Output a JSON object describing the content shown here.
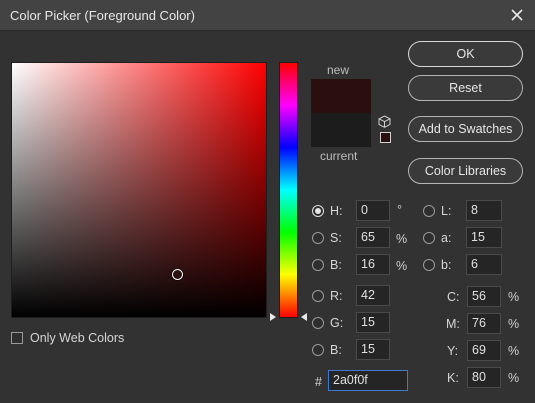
{
  "window": {
    "title": "Color Picker (Foreground Color)"
  },
  "colors": {
    "new": "#2a0f0f",
    "current": "#1c1c1c",
    "hue": "#ff0000"
  },
  "swatches": {
    "new_label": "new",
    "current_label": "current"
  },
  "buttons": {
    "ok": "OK",
    "reset": "Reset",
    "add_to_swatches": "Add to Swatches",
    "color_libraries": "Color Libraries"
  },
  "hsb": {
    "h": {
      "label": "H:",
      "value": "0",
      "unit": "°",
      "selected": true
    },
    "s": {
      "label": "S:",
      "value": "65",
      "unit": "%"
    },
    "b": {
      "label": "B:",
      "value": "16",
      "unit": "%"
    }
  },
  "lab": {
    "l": {
      "label": "L:",
      "value": "8"
    },
    "a": {
      "label": "a:",
      "value": "15"
    },
    "b": {
      "label": "b:",
      "value": "6"
    }
  },
  "rgb": {
    "r": {
      "label": "R:",
      "value": "42"
    },
    "g": {
      "label": "G:",
      "value": "15"
    },
    "b": {
      "label": "B:",
      "value": "15"
    }
  },
  "cmyk": {
    "c": {
      "label": "C:",
      "value": "56",
      "unit": "%"
    },
    "m": {
      "label": "M:",
      "value": "76",
      "unit": "%"
    },
    "y": {
      "label": "Y:",
      "value": "69",
      "unit": "%"
    },
    "k": {
      "label": "K:",
      "value": "80",
      "unit": "%"
    }
  },
  "hex": {
    "label": "#",
    "value": "2a0f0f"
  },
  "only_web_colors": {
    "label": "Only Web Colors",
    "checked": false
  },
  "icons": {
    "close": "close-icon",
    "cube": "web-safe-cube-icon"
  }
}
